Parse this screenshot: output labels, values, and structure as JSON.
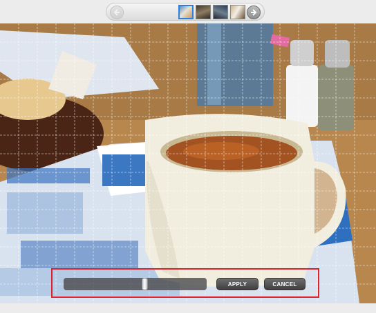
{
  "filmstrip": {
    "prev_icon": "arrow-left-icon",
    "next_icon": "arrow-right-icon",
    "selected_index": 0,
    "thumbnail_count": 4
  },
  "photo": {
    "subject_icon": "coffee-mug-photo",
    "grid_overlay": true
  },
  "controls": {
    "slider_value": 0.57,
    "apply_label": "APPLY",
    "cancel_label": "CANCEL"
  },
  "colors": {
    "highlight": "#e0202a",
    "selected_thumb": "#2f7fd9"
  }
}
